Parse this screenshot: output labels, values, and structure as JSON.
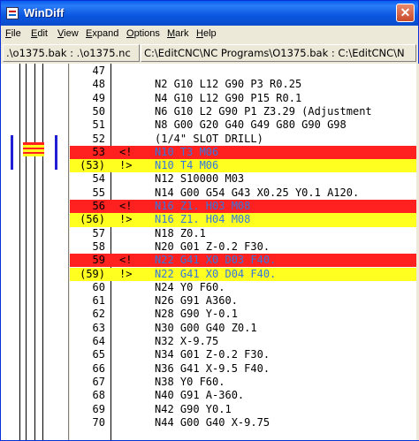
{
  "window": {
    "title": "WinDiff",
    "close_glyph": "✕"
  },
  "menu": [
    {
      "key": "F",
      "rest": "ile"
    },
    {
      "key": "E",
      "rest": "dit"
    },
    {
      "key": "V",
      "rest": "iew"
    },
    {
      "key": "E",
      "rest": "xpand"
    },
    {
      "key": "O",
      "rest": "ptions"
    },
    {
      "key": "M",
      "rest": "ark"
    },
    {
      "key": "H",
      "rest": "elp"
    }
  ],
  "paths": {
    "left": ".\\o1375.bak : .\\o1375.nc",
    "right": "C:\\EditCNC\\NC Programs\\O1375.bak : C:\\EditCNC\\N"
  },
  "rows": [
    {
      "num": "47",
      "mark": "",
      "code": "",
      "style": ""
    },
    {
      "num": "48",
      "mark": "",
      "code": "N2 G10 L12 G90 P3 R0.25",
      "style": ""
    },
    {
      "num": "49",
      "mark": "",
      "code": "N4 G10 L12 G90 P15 R0.1",
      "style": ""
    },
    {
      "num": "50",
      "mark": "",
      "code": "N6 G10 L2 G90 P1 Z3.29 (Adjustment",
      "style": ""
    },
    {
      "num": "51",
      "mark": "",
      "code": "N8 G00 G20 G40 G49 G80 G90 G98",
      "style": ""
    },
    {
      "num": "52",
      "mark": "",
      "code": "(1/4\" SLOT DRILL)",
      "style": ""
    },
    {
      "num": "53",
      "mark": "<!",
      "code": "N10 T3 M06",
      "style": "red"
    },
    {
      "num": "(53)",
      "mark": "!>",
      "code": "N10 T4 M06",
      "style": "yellow"
    },
    {
      "num": "54",
      "mark": "",
      "code": "N12 S10000 M03",
      "style": ""
    },
    {
      "num": "55",
      "mark": "",
      "code": "N14 G00 G54 G43 X0.25 Y0.1 A120.",
      "style": ""
    },
    {
      "num": "56",
      "mark": "<!",
      "code": "N16 Z1. H03 M08",
      "style": "red"
    },
    {
      "num": "(56)",
      "mark": "!>",
      "code": "N16 Z1. H04 M08",
      "style": "yellow"
    },
    {
      "num": "57",
      "mark": "",
      "code": "N18 Z0.1",
      "style": ""
    },
    {
      "num": "58",
      "mark": "",
      "code": "N20 G01 Z-0.2 F30.",
      "style": ""
    },
    {
      "num": "59",
      "mark": "<!",
      "code": "N22 G41 X0 D03 F40.",
      "style": "red"
    },
    {
      "num": "(59)",
      "mark": "!>",
      "code": "N22 G41 X0 D04 F40.",
      "style": "yellow"
    },
    {
      "num": "60",
      "mark": "",
      "code": "N24 Y0 F60.",
      "style": ""
    },
    {
      "num": "61",
      "mark": "",
      "code": "N26 G91 A360.",
      "style": ""
    },
    {
      "num": "62",
      "mark": "",
      "code": "N28 G90 Y-0.1",
      "style": ""
    },
    {
      "num": "63",
      "mark": "",
      "code": "N30 G00 G40 Z0.1",
      "style": ""
    },
    {
      "num": "64",
      "mark": "",
      "code": "N32 X-9.75",
      "style": ""
    },
    {
      "num": "65",
      "mark": "",
      "code": "N34 G01 Z-0.2 F30.",
      "style": ""
    },
    {
      "num": "66",
      "mark": "",
      "code": "N36 G41 X-9.5 F40.",
      "style": ""
    },
    {
      "num": "67",
      "mark": "",
      "code": "N38 Y0 F60.",
      "style": ""
    },
    {
      "num": "68",
      "mark": "",
      "code": "N40 G91 A-360.",
      "style": ""
    },
    {
      "num": "69",
      "mark": "",
      "code": "N42 G90 Y0.1",
      "style": ""
    },
    {
      "num": "70",
      "mark": "",
      "code": "N44 G00 G40 X-9.75",
      "style": ""
    }
  ],
  "colors": {
    "removed": "#ff2020",
    "added": "#ffff20",
    "highlight_text": "#3377dd",
    "marker": "#1f1fd6"
  }
}
